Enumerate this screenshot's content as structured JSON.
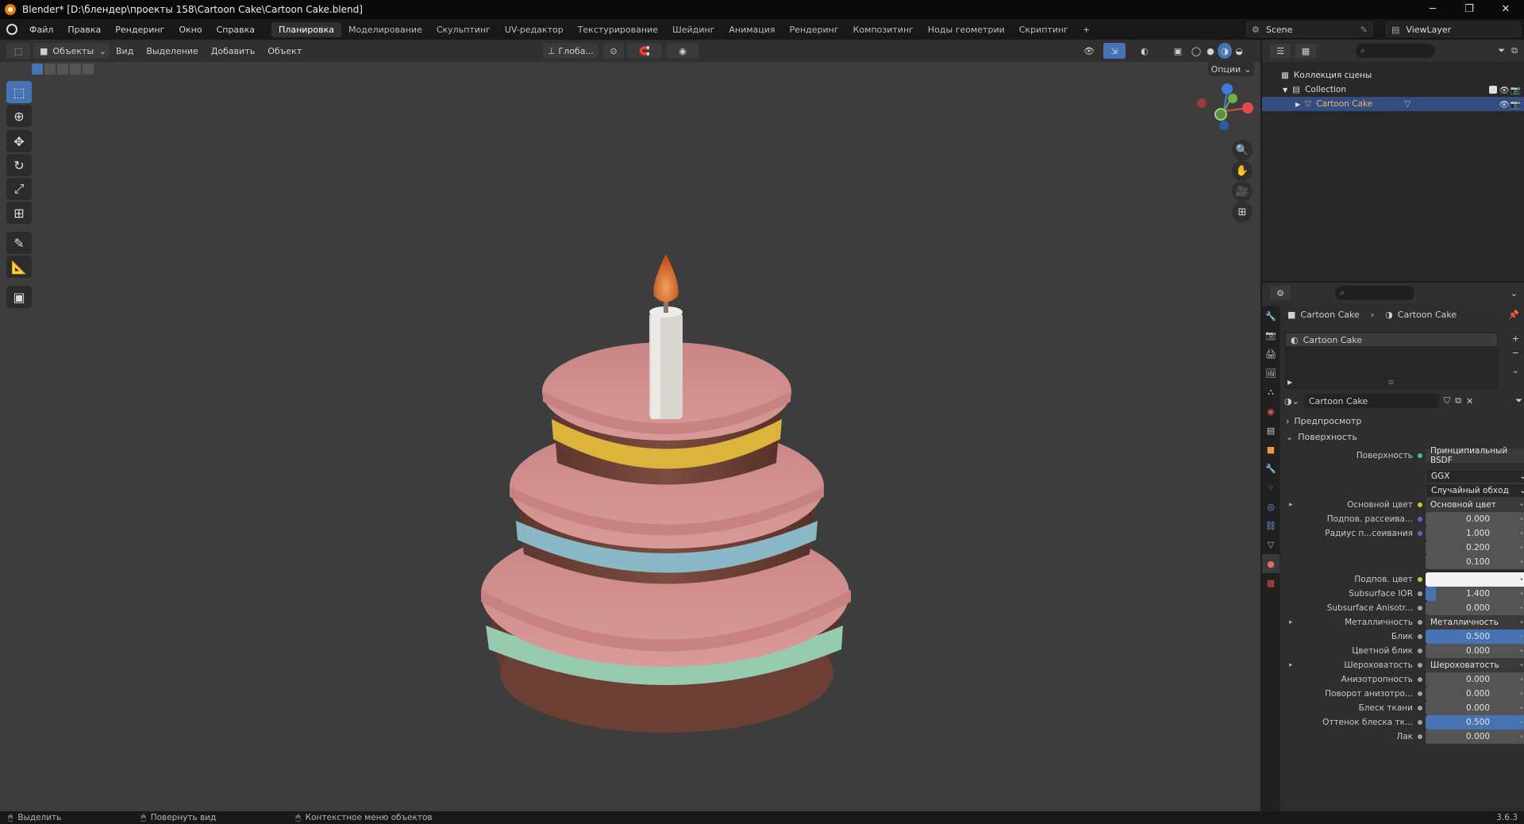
{
  "title": "Blender* [D:\\блендер\\проекты 158\\Cartoon Cake\\Cartoon Cake.blend]",
  "window_controls": [
    "─",
    "❐",
    "✕"
  ],
  "menu": [
    "Файл",
    "Правка",
    "Рендеринг",
    "Окно",
    "Справка"
  ],
  "workspaces": [
    "Планировка",
    "Моделирование",
    "Скульптинг",
    "UV-редактор",
    "Текстурирование",
    "Шейдинг",
    "Анимация",
    "Рендеринг",
    "Композитинг",
    "Ноды геометрии",
    "Скриптинг"
  ],
  "workspace_add": "+",
  "scene_name": "Scene",
  "view_layer": "ViewLayer",
  "viewport": {
    "mode": "Объекты",
    "menus": [
      "Вид",
      "Выделение",
      "Добавить",
      "Объект"
    ],
    "transform_orientation": "Глоба...",
    "options": "Опции"
  },
  "outliner": {
    "root": "Коллекция сцены",
    "collection": "Collection",
    "object": "Cartoon Cake"
  },
  "properties": {
    "breadcrumb_object": "Cartoon Cake",
    "breadcrumb_material": "Cartoon Cake",
    "material_slot": "Cartoon Cake",
    "material_name": "Cartoon Cake",
    "sections": {
      "preview": "Предпросмотр",
      "surface": "Поверхность"
    },
    "surface_label": "Поверхность",
    "surface_value": "Принципиальный BSDF",
    "distribution": "GGX",
    "subsurface_method": "Случайный обход",
    "rows": [
      {
        "label": "Основной цвет",
        "value": "Основной цвет",
        "kind": "link",
        "dot": "#c7c729",
        "expand": true
      },
      {
        "label": "Подпов. рассеива...",
        "value": "0.000",
        "kind": "num",
        "dot": "#6363c7"
      },
      {
        "label": "Радиус п...сеивания",
        "value": "1.000",
        "kind": "num",
        "dot": "#6363c7"
      },
      {
        "label": "",
        "value": "0.200",
        "kind": "num"
      },
      {
        "label": "",
        "value": "0.100",
        "kind": "num"
      },
      {
        "label": "Подпов. цвет",
        "value": "",
        "kind": "color",
        "dot": "#c7c729"
      },
      {
        "label": "Subsurface IOR",
        "value": "1.400",
        "kind": "partial",
        "dot": "#a1a1a1"
      },
      {
        "label": "Subsurface Anisotr...",
        "value": "0.000",
        "kind": "num",
        "dot": "#a1a1a1"
      },
      {
        "label": "Металличность",
        "value": "Металличность",
        "kind": "link",
        "dot": "#a1a1a1",
        "expand": true
      },
      {
        "label": "Блик",
        "value": "0.500",
        "kind": "blue",
        "dot": "#a1a1a1"
      },
      {
        "label": "Цветной блик",
        "value": "0.000",
        "kind": "num",
        "dot": "#a1a1a1"
      },
      {
        "label": "Шероховатость",
        "value": "Шероховатость",
        "kind": "link",
        "dot": "#a1a1a1",
        "expand": true
      },
      {
        "label": "Анизотропность",
        "value": "0.000",
        "kind": "num",
        "dot": "#a1a1a1"
      },
      {
        "label": "Поворот анизотро...",
        "value": "0.000",
        "kind": "num",
        "dot": "#a1a1a1"
      },
      {
        "label": "Блеск ткани",
        "value": "0.000",
        "kind": "num",
        "dot": "#a1a1a1"
      },
      {
        "label": "Оттенок блеска тк...",
        "value": "0.500",
        "kind": "blue",
        "dot": "#a1a1a1"
      },
      {
        "label": "Лак",
        "value": "0.000",
        "kind": "num",
        "dot": "#a1a1a1"
      }
    ]
  },
  "status": {
    "select": "Выделить",
    "rotate": "Повернуть вид",
    "context": "Контекстное меню объектов",
    "version": "3.6.3"
  },
  "colors": {
    "accent": "#4772b3",
    "frosting": "#d48c8c",
    "chocolate": "#74463a",
    "yellow_ribbon": "#d9b63a",
    "blue_ribbon": "#8ab6c4",
    "green_ribbon": "#9cd1b4",
    "flame": "#d9631e",
    "candle": "#dcdad4"
  }
}
